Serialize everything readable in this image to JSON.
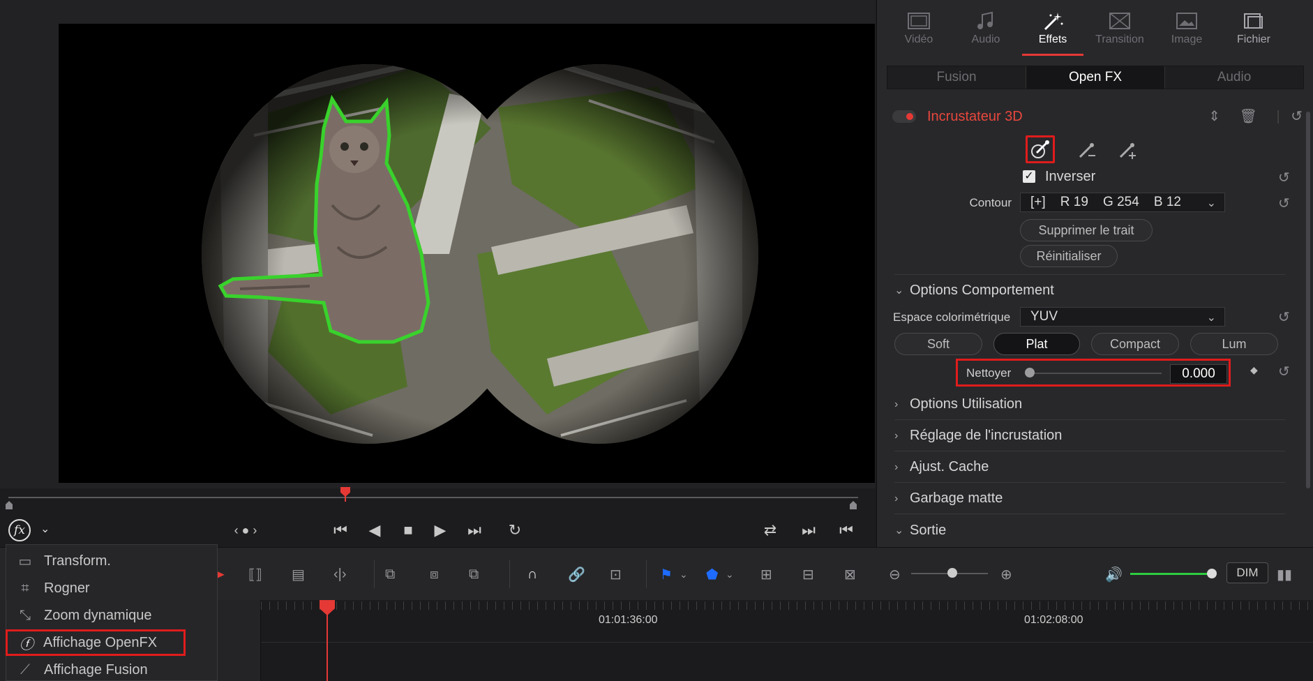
{
  "right_panel": {
    "tabs": [
      {
        "label": "Vidéo",
        "icon": "film-icon"
      },
      {
        "label": "Audio",
        "icon": "music-note-icon"
      },
      {
        "label": "Effets",
        "icon": "magic-wand-icon"
      },
      {
        "label": "Transition",
        "icon": "transition-icon"
      },
      {
        "label": "Image",
        "icon": "image-icon"
      },
      {
        "label": "Fichier",
        "icon": "file-stack-icon"
      }
    ],
    "subtabs": [
      "Fusion",
      "Open FX",
      "Audio"
    ],
    "effect": {
      "title": "Incrustateur 3D",
      "invert_label": "Inverser",
      "invert_checked": true,
      "contour_label": "Contour",
      "contour_value": "[+]    R 19    G 254    B 12",
      "remove_stroke_btn": "Supprimer le trait",
      "reset_btn": "Réinitialiser"
    },
    "behaviour": {
      "section_title": "Options Comportement",
      "colorspace_label": "Espace colorimétrique",
      "colorspace_value": "YUV",
      "modes": [
        "Soft",
        "Plat",
        "Compact",
        "Lum"
      ],
      "active_mode": "Plat",
      "clean_label": "Nettoyer",
      "clean_value": "0.000"
    },
    "sections": [
      "Options Utilisation",
      "Réglage de l'incrustation",
      "Ajust. Cache",
      "Garbage matte",
      "Sortie"
    ]
  },
  "popup_menu": {
    "items": [
      {
        "label": "Transform.",
        "icon": "transform-icon"
      },
      {
        "label": "Rogner",
        "icon": "crop-icon"
      },
      {
        "label": "Zoom dynamique",
        "icon": "dynamic-zoom-icon"
      },
      {
        "label": "Affichage OpenFX",
        "icon": "fx-icon",
        "highlighted": true
      },
      {
        "label": "Affichage Fusion",
        "icon": "fusion-wand-icon"
      }
    ]
  },
  "timeline": {
    "timecodes": [
      "01:01:36:00",
      "01:02:08:00"
    ]
  },
  "toolbar": {
    "dim_label": "DIM"
  },
  "colors": {
    "accent_red": "#e53935",
    "highlight_box": "#e01c1c",
    "volume_green": "#2ecc40",
    "flag_blue": "#1e6cff"
  }
}
